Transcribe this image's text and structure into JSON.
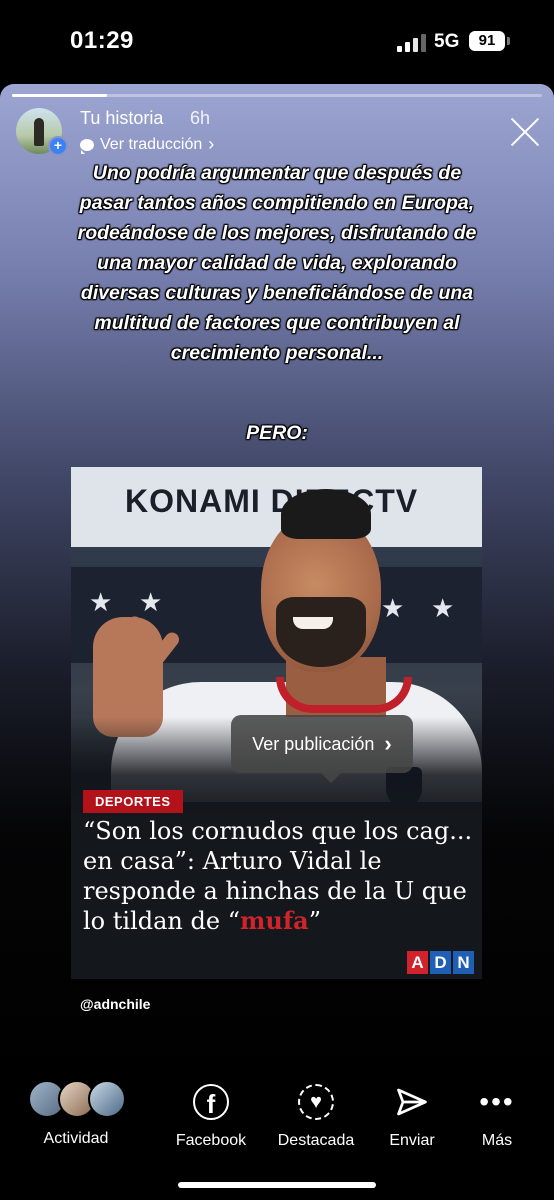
{
  "status_bar": {
    "time": "01:29",
    "network": "5G",
    "battery": "91"
  },
  "story": {
    "progress_fraction": 0.18,
    "user": "Tu historia",
    "age": "6h",
    "translation_link": "Ver traducción",
    "quote": "Uno podría argumentar que después de pasar tantos años compitiendo en Europa, rodeándose de los mejores, disfrutando de una mayor calidad de vida, explorando diversas culturas y beneficiándose de una multitud de factores que contribuyen al crecimiento personal...",
    "emphasis": "PERO:",
    "handle": "@adnchile"
  },
  "post": {
    "banner_text": "KONAMI  DIRECTV",
    "view_post_label": "Ver publicación",
    "tag": "DEPORTES",
    "headline_part1": "“Son los cornudos que los cag... en casa”: Arturo Vidal le responde a hinchas de la U que lo tildan de “",
    "headline_highlight": "mufa",
    "headline_part2": "”",
    "brand_letters": [
      "A",
      "D",
      "N"
    ],
    "brand_colors": [
      "#d0232b",
      "#1f5fb5",
      "#1f5fb5"
    ]
  },
  "bottom_nav": {
    "activity": "Actividad",
    "facebook": "Facebook",
    "featured": "Destacada",
    "send": "Enviar",
    "more": "Más"
  },
  "colors": {
    "accent_red": "#b3121b",
    "plus_badge": "#3b82f6"
  }
}
